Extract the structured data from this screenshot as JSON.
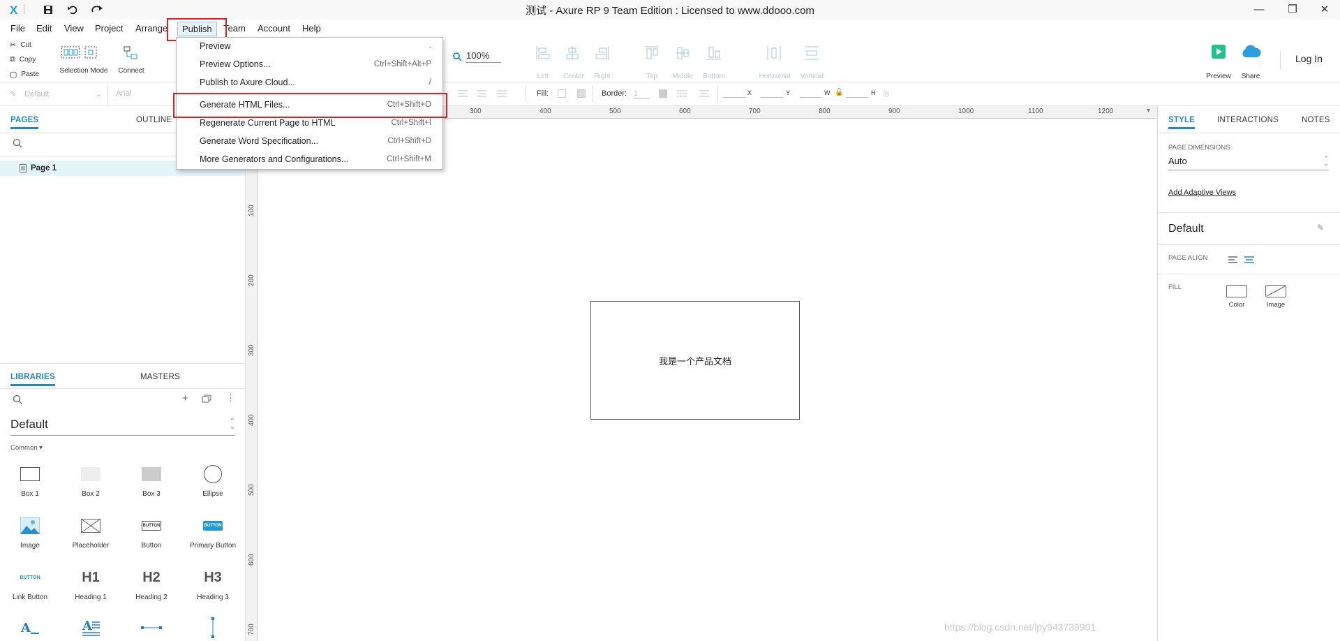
{
  "window": {
    "title": "测试 - Axure RP 9 Team Edition : Licensed to www.ddooo.com",
    "logo": "X",
    "controls": [
      "—",
      "❐",
      "✕"
    ]
  },
  "quickbar": {
    "save_icon": "save-icon",
    "undo_icon": "undo-icon",
    "redo_icon": "redo-icon"
  },
  "menubar": {
    "items": [
      "File",
      "Edit",
      "View",
      "Project",
      "Arrange",
      "Publish",
      "Team",
      "Account",
      "Help"
    ]
  },
  "toolbar": {
    "cut": "Cut",
    "copy": "Copy",
    "paste": "Paste",
    "selection_mode": "Selection Mode",
    "connect": "Connect",
    "zoom": "100%",
    "align": [
      "Left",
      "Center",
      "Right",
      "Top",
      "Middle",
      "Bottom"
    ],
    "distribute": [
      "Horizontal",
      "Vertical"
    ],
    "preview": "Preview",
    "share": "Share",
    "login": "Log In",
    "accent_color": "#1e9bd7",
    "preview_color": "#1fc48a"
  },
  "formatbar": {
    "style": "Default",
    "font": "Arial",
    "fill_label": "Fill:",
    "border_label": "Border:",
    "border_value": "1",
    "x": "X",
    "y": "Y",
    "w": "W",
    "h": "H"
  },
  "publish_menu": {
    "items": [
      {
        "label": "Preview",
        "shortcut": "."
      },
      {
        "label": "Preview Options...",
        "shortcut": "Ctrl+Shift+Alt+P"
      },
      {
        "label": "Publish to Axure Cloud...",
        "shortcut": "/"
      },
      {
        "label": "Generate HTML Files...",
        "shortcut": "Ctrl+Shift+O"
      },
      {
        "label": "Regenerate Current Page to HTML",
        "shortcut": "Ctrl+Shift+I"
      },
      {
        "label": "Generate Word Specification...",
        "shortcut": "Ctrl+Shift+D"
      },
      {
        "label": "More Generators and Configurations...",
        "shortcut": "Ctrl+Shift+M"
      }
    ],
    "highlight_color": "#e02020"
  },
  "pages_panel": {
    "tabs": [
      "PAGES",
      "OUTLINE"
    ],
    "pages": [
      "Page 1"
    ]
  },
  "libraries_panel": {
    "tabs": [
      "LIBRARIES",
      "MASTERS"
    ],
    "library": "Default",
    "category": "Common ▾",
    "widgets": [
      "Box 1",
      "Box 2",
      "Box 3",
      "Ellipse",
      "Image",
      "Placeholder",
      "Button",
      "Primary Button",
      "Link Button",
      "Heading 1",
      "Heading 2",
      "Heading 3"
    ],
    "button_text": "BUTTON",
    "h1": "H1",
    "h2": "H2",
    "h3": "H3"
  },
  "canvas": {
    "ruler_h": [
      "300",
      "400",
      "500",
      "600",
      "700",
      "800",
      "900",
      "1000",
      "1100",
      "1200"
    ],
    "ruler_v": [
      "100",
      "200",
      "300",
      "400",
      "500",
      "600",
      "700"
    ],
    "box_text": "我是一个产品文档"
  },
  "style_panel": {
    "tabs": [
      "STYLE",
      "INTERACTIONS",
      "NOTES"
    ],
    "page_dimensions_label": "PAGE DIMENSIONS",
    "page_dimensions_value": "Auto",
    "adaptive_link": "Add Adaptive Views",
    "default_heading": "Default",
    "page_align_label": "PAGE ALIGN",
    "fill_label": "FILL",
    "fill_color": "Color",
    "fill_image": "Image"
  },
  "watermark": "https://blog.csdn.net/lpy943739901"
}
